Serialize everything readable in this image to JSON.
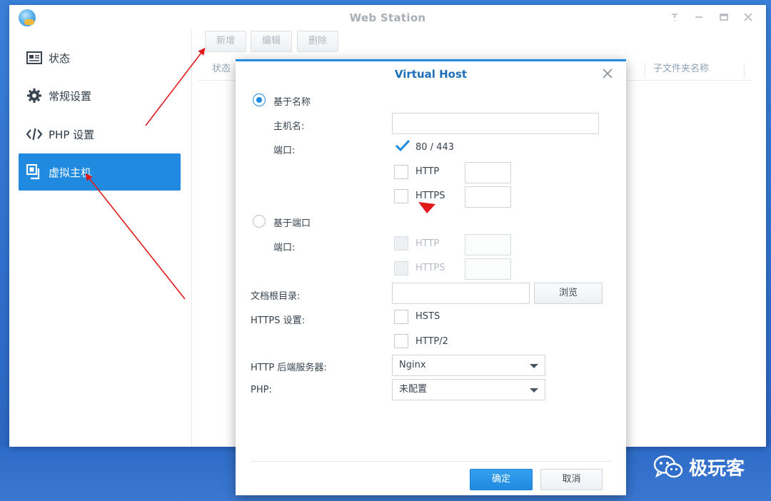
{
  "window": {
    "title": "Web Station"
  },
  "sidebar": {
    "items": [
      {
        "label": "状态",
        "icon": "status-card-icon"
      },
      {
        "label": "常规设置",
        "icon": "gear-icon"
      },
      {
        "label": "PHP 设置",
        "icon": "code-icon"
      },
      {
        "label": "虚拟主机",
        "icon": "virtual-host-icon",
        "active": true
      }
    ]
  },
  "toolbar": {
    "add_label": "新增",
    "edit_label": "编辑",
    "delete_label": "删除"
  },
  "table": {
    "columns": [
      "状态",
      "子文件夹名称"
    ]
  },
  "dialog": {
    "title": "Virtual Host",
    "name_based": {
      "label": "基于名称",
      "selected": true,
      "hostname_label": "主机名:",
      "hostname_value": "",
      "port_label": "端口:",
      "ports": [
        {
          "label": "80 / 443",
          "checked": true
        },
        {
          "label": "HTTP",
          "checked": false,
          "value": ""
        },
        {
          "label": "HTTPS",
          "checked": false,
          "value": ""
        }
      ]
    },
    "port_based": {
      "label": "基于端口",
      "selected": false,
      "port_label": "端口:",
      "ports": [
        {
          "label": "HTTP",
          "checked": false,
          "value": ""
        },
        {
          "label": "HTTPS",
          "checked": false,
          "value": ""
        }
      ]
    },
    "docroot": {
      "label": "文档根目录:",
      "value": "",
      "browse_label": "浏览"
    },
    "https_settings": {
      "label": "HTTPS 设置:",
      "options": [
        {
          "label": "HSTS",
          "checked": false
        },
        {
          "label": "HTTP/2",
          "checked": false
        }
      ]
    },
    "backend": {
      "label": "HTTP 后端服务器:",
      "value": "Nginx"
    },
    "php": {
      "label": "PHP:",
      "value": "未配置"
    },
    "ok_label": "确定",
    "cancel_label": "取消"
  },
  "watermark": {
    "text": "极玩客"
  },
  "colors": {
    "accent": "#1f8ae0",
    "desktop": "#3a7fd8",
    "annotation": "#e01a1a"
  }
}
